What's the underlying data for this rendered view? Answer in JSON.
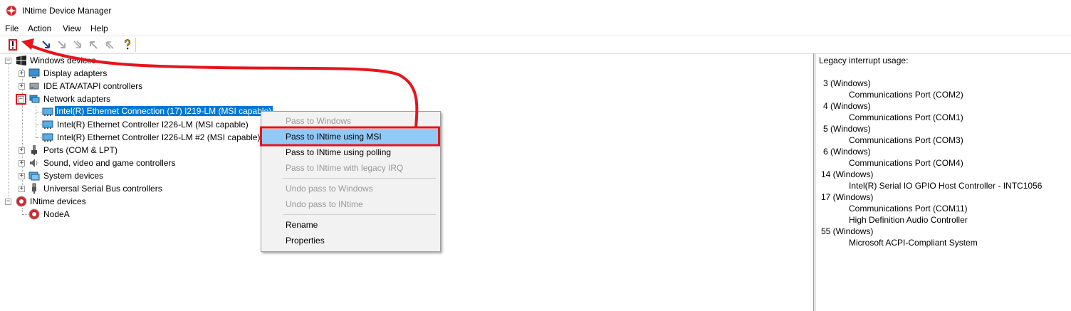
{
  "window": {
    "title": "INtime Device Manager"
  },
  "menu": [
    "File",
    "Action",
    "View",
    "Help"
  ],
  "toolbar": {
    "buttons": [
      "exclamation-icon",
      "arrow-back-icon",
      "pass-down-icon",
      "pass-down-disabled-icon",
      "pass-down-multi-disabled-icon",
      "pass-up-disabled-icon",
      "pass-up-multi-disabled-icon",
      "help-icon"
    ]
  },
  "tree": {
    "windows_devices": "Windows devices",
    "display_adapters": "Display adapters",
    "ide": "IDE ATA/ATAPI controllers",
    "network_adapters": "Network adapters",
    "nic1": "Intel(R) Ethernet Connection (17) I219-LM (MSI capable)",
    "nic2": "Intel(R) Ethernet Controller I226-LM (MSI capable)",
    "nic3": "Intel(R) Ethernet Controller I226-LM #2 (MSI capable)",
    "ports": "Ports (COM & LPT)",
    "sound": "Sound, video and game controllers",
    "system": "System devices",
    "usb": "Universal Serial Bus controllers",
    "intime_devices": "INtime devices",
    "node": "NodeA"
  },
  "context_menu": {
    "pass_windows": "Pass to Windows",
    "pass_msi": "Pass to INtime using MSI",
    "pass_polling": "Pass to INtime using polling",
    "pass_legacy": "Pass to INtime with legacy IRQ",
    "undo_windows": "Undo pass to Windows",
    "undo_intime": "Undo pass to INtime",
    "rename": "Rename",
    "properties": "Properties"
  },
  "right_pane": {
    "heading": "Legacy interrupt usage:",
    "irqs": [
      {
        "irq": "3 (Windows)",
        "devices": [
          "Communications Port (COM2)"
        ]
      },
      {
        "irq": "4 (Windows)",
        "devices": [
          "Communications Port (COM1)"
        ]
      },
      {
        "irq": "5 (Windows)",
        "devices": [
          "Communications Port (COM3)"
        ]
      },
      {
        "irq": "6 (Windows)",
        "devices": [
          "Communications Port (COM4)"
        ]
      },
      {
        "irq": "14 (Windows)",
        "devices": [
          "Intel(R) Serial IO GPIO Host Controller - INTC1056"
        ]
      },
      {
        "irq": "17 (Windows)",
        "devices": [
          "Communications Port (COM11)",
          "High Definition Audio Controller"
        ]
      },
      {
        "irq": "55 (Windows)",
        "devices": [
          "Microsoft ACPI-Compliant System"
        ]
      }
    ]
  },
  "colors": {
    "highlight": "#0078d7",
    "menu_hover": "#91c9f7",
    "annotation": "#e8141b"
  }
}
